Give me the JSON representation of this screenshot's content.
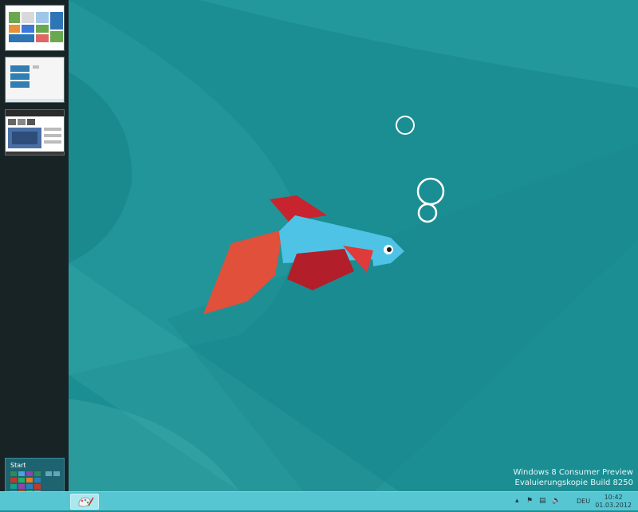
{
  "desktop": {
    "watermark": {
      "line1": "Windows 8 Consumer Preview",
      "line2": "Evaluierungskopie Build 8250"
    }
  },
  "switcher": {
    "start_label": "Start"
  },
  "taskbar": {
    "language": "DEU",
    "time": "10:42",
    "date": "01.03.2012"
  },
  "colors": {
    "desktop_bg": "#1b8e93",
    "taskbar": "#57c6d3",
    "switcher": "#182326"
  }
}
